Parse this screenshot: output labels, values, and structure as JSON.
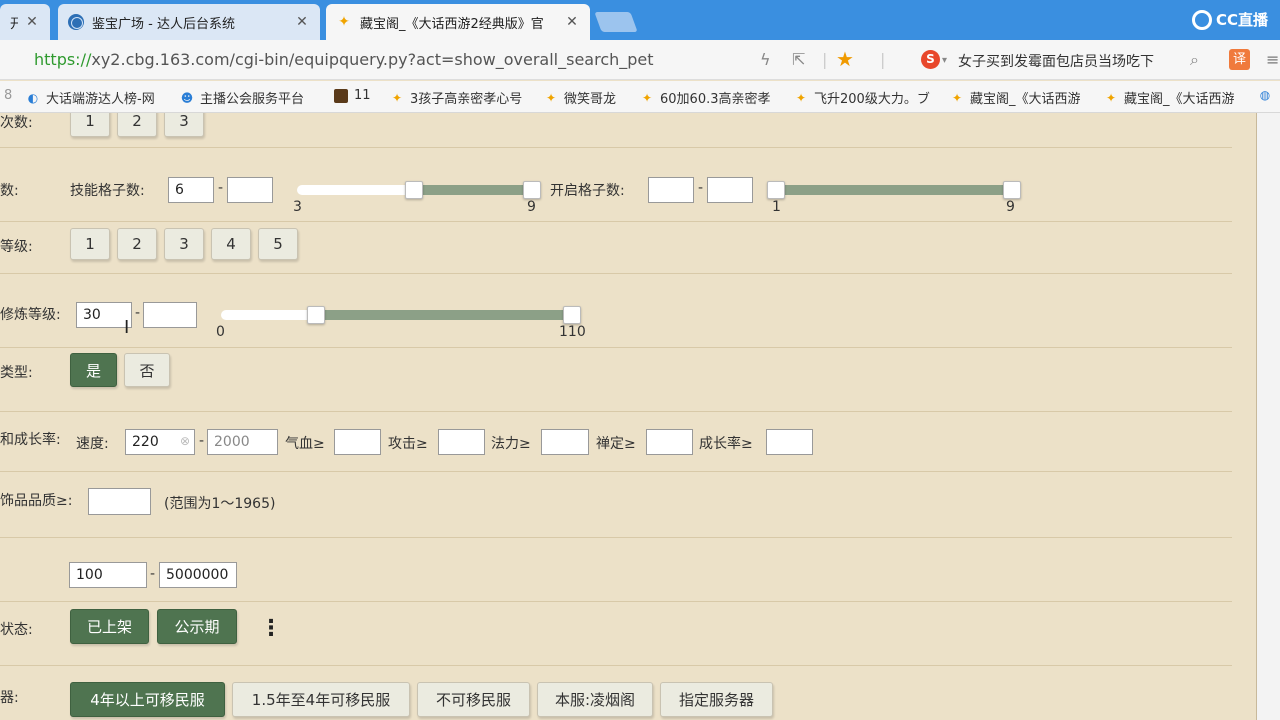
{
  "browser": {
    "tabs": [
      {
        "title": "开始",
        "active": false
      },
      {
        "title": "鉴宝广场 - 达人后台系统",
        "active": false
      },
      {
        "title": "藏宝阁_《大话西游2经典版》官",
        "active": true
      }
    ],
    "close_glyph": "✕",
    "recorder_brand": "CC直播",
    "url_scheme": "https://",
    "url_rest": "xy2.cbg.163.com/cgi-bin/equipquery.py?act=show_overall_search_pet",
    "news_ticker": "女子买到发霉面包店员当场吃下",
    "sogou_glyph": "S",
    "translate_glyph": "译",
    "bookmarks": [
      {
        "label": "大话端游达人榜-网",
        "icon": "blue-c-icon"
      },
      {
        "label": "主播公会服务平台",
        "icon": "blue-face-icon"
      },
      {
        "label": "11",
        "icon": "game-icon"
      },
      {
        "label": "3孩子高亲密孝心号",
        "icon": "bird-icon"
      },
      {
        "label": "微笑哥龙",
        "icon": "bird-icon"
      },
      {
        "label": "60加60.3高亲密孝",
        "icon": "bird-icon"
      },
      {
        "label": "飞升200级大力。ブ",
        "icon": "bird-icon"
      },
      {
        "label": "藏宝阁_《大话西游",
        "icon": "bird-icon"
      },
      {
        "label": "藏宝阁_《大话西游",
        "icon": "bird-icon"
      }
    ]
  },
  "form": {
    "rank": {
      "label": "次数:",
      "options": [
        "1",
        "2",
        "3"
      ]
    },
    "slots": {
      "label": "数:",
      "skill_label": "技能格子数:",
      "skill_min": "6",
      "skill_max": "",
      "skill_range_min": "3",
      "skill_range_max": "9",
      "open_label": "开启格子数:",
      "open_min": "",
      "open_max": "",
      "open_range_min": "1",
      "open_range_max": "9"
    },
    "grade": {
      "label": "等级:",
      "options": [
        "1",
        "2",
        "3",
        "4",
        "5"
      ]
    },
    "cultivation": {
      "label": "修炼等级:",
      "min": "30",
      "max": "",
      "range_min": "0",
      "range_max": "110"
    },
    "type": {
      "label": "类型:",
      "options": [
        "是",
        "否"
      ],
      "selected": "是"
    },
    "growth": {
      "label": "和成长率:",
      "speed_label": "速度:",
      "speed_min": "220",
      "speed_max": "2000",
      "hp_label": "气血≥",
      "atk_label": "攻击≥",
      "mana_label": "法力≥",
      "zen_label": "禅定≥",
      "growth_label": "成长率≥"
    },
    "quality": {
      "label": "饰品品质≥:",
      "value": "",
      "hint": "(范围为1～1965)"
    },
    "price": {
      "min": "100",
      "max": "5000000"
    },
    "status": {
      "label": "状态:",
      "options": [
        "已上架",
        "公示期"
      ],
      "selected": "已上架"
    },
    "server": {
      "label": "器:",
      "options": [
        "4年以上可移民服",
        "1.5年至4年可移民服",
        "不可移民服",
        "本服:凌烟阁",
        "指定服务器"
      ],
      "selected": "4年以上可移民服"
    },
    "dash": "-"
  }
}
